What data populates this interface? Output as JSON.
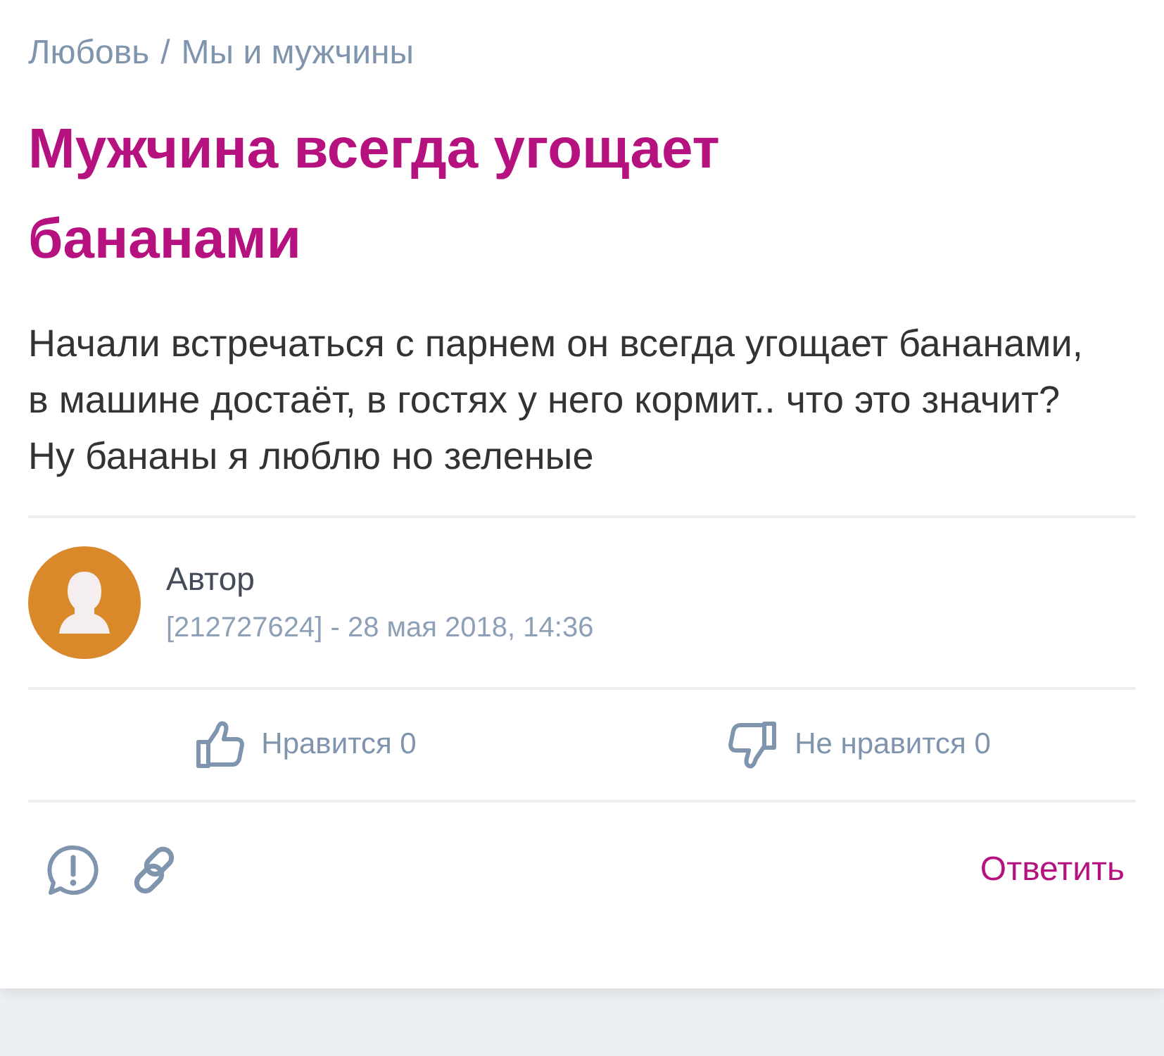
{
  "breadcrumb": {
    "items": [
      "Любовь",
      "Мы и мужчины"
    ],
    "separator": "/"
  },
  "title": "Мужчина всегда угощает бананами",
  "body": "Начали встречаться с парнем он всегда угощает бананами, в машине достаёт, в гостях у него кормит.. что это значит? Ну бананы я люблю но зеленые",
  "author": {
    "name": "Автор",
    "meta": "[212727624] - 28 мая 2018, 14:36"
  },
  "votes": [
    {
      "kind": "like",
      "label": "Нравится 0"
    },
    {
      "kind": "dislike",
      "label": "Не нравится 0"
    }
  ],
  "reply_button": "Ответить"
}
